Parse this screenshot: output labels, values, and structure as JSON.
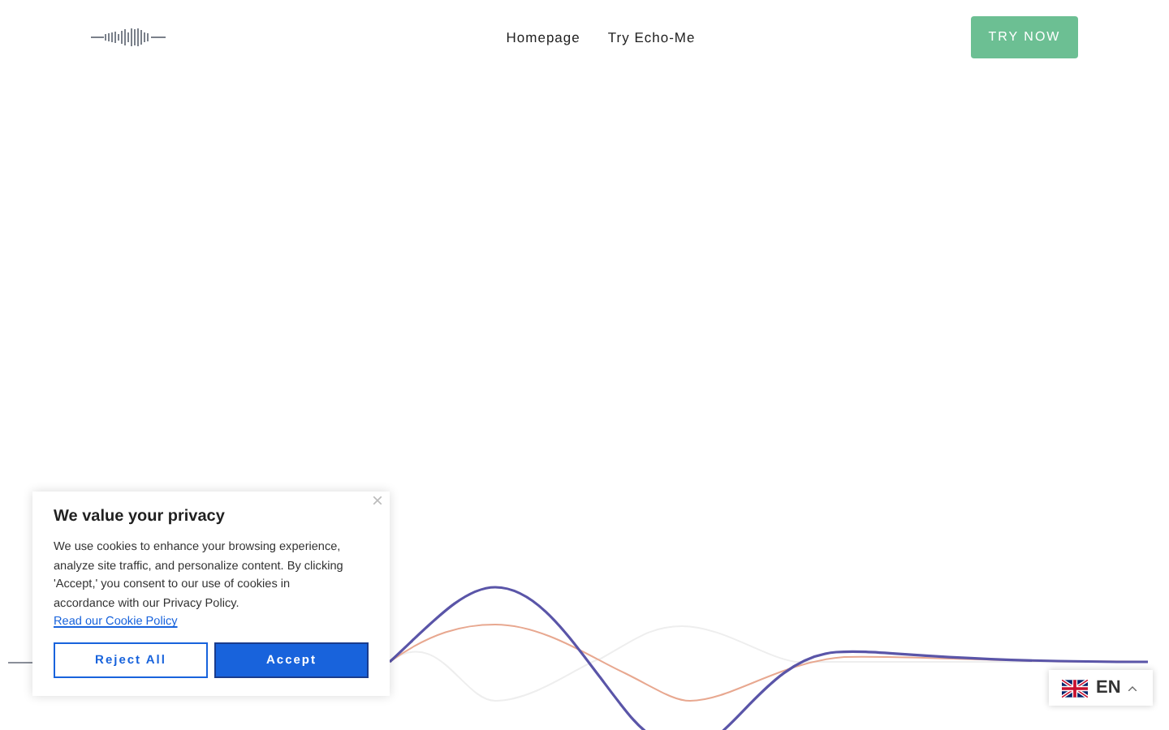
{
  "header": {
    "nav": [
      {
        "label": "Homepage"
      },
      {
        "label": "Try Echo-Me"
      }
    ],
    "cta": "TRY NOW"
  },
  "cookie_banner": {
    "title": "We value your privacy",
    "text": "We use cookies to enhance your browsing experience, analyze site traffic, and personalize content. By clicking 'Accept,' you consent to our use of cookies in accordance with our Privacy Policy.",
    "link": "Read our Cookie Policy",
    "buttons": [
      {
        "label": "Reject All",
        "kind": "secondary"
      },
      {
        "label": "Accept",
        "kind": "primary"
      }
    ]
  },
  "language_switcher": {
    "code": "EN"
  }
}
